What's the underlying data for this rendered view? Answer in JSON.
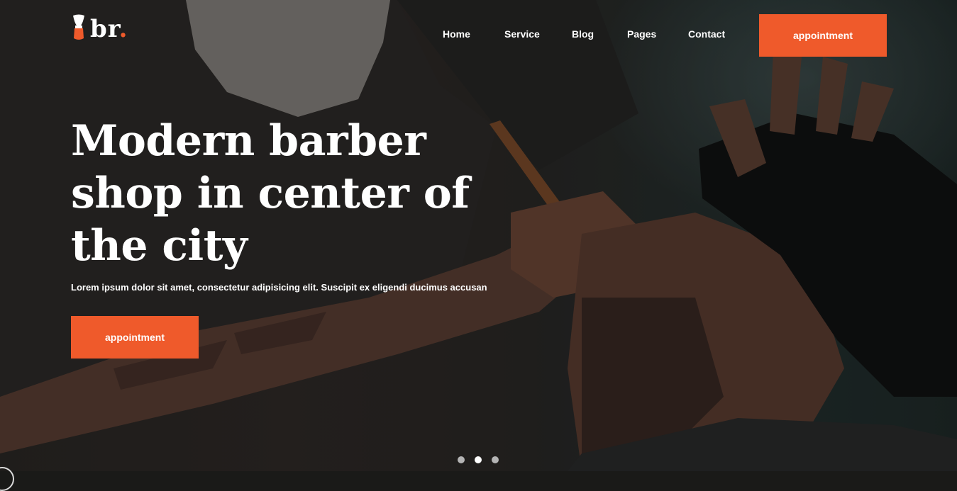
{
  "brand": {
    "name": "br",
    "dot": ".",
    "accent_color": "#ef5a2b"
  },
  "nav": {
    "items": [
      {
        "label": "Home"
      },
      {
        "label": "Service"
      },
      {
        "label": "Blog"
      },
      {
        "label": "Pages"
      },
      {
        "label": "Contact"
      }
    ],
    "cta_label": "appointment"
  },
  "hero": {
    "headline": "Modern barber shop in center of the city",
    "subtext": "Lorem ipsum dolor sit amet, consectetur adipisicing elit. Suscipit ex eligendi ducimus accusan",
    "cta_label": "appointment",
    "background": "barber-shaving-customer-photo",
    "slider_dots": 3,
    "active_dot": 1
  }
}
